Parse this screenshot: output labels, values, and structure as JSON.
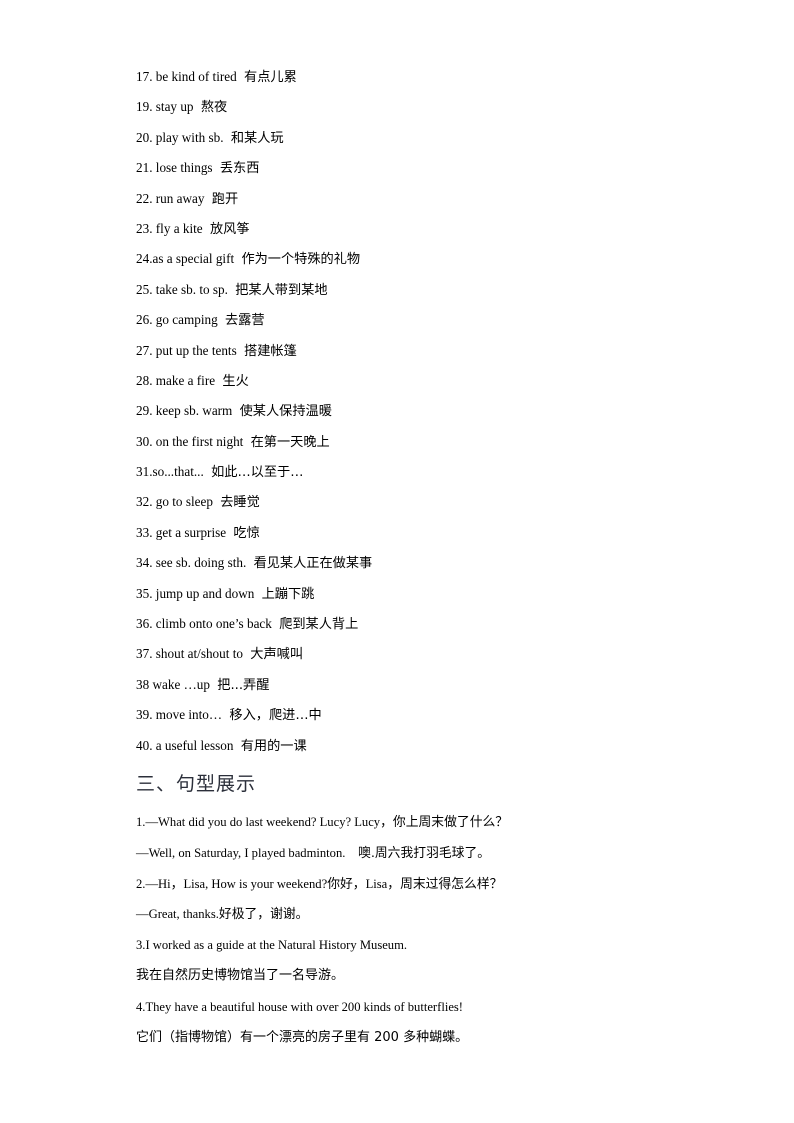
{
  "document": {
    "page_background": "#ffffff",
    "text_color": "#000000",
    "heading_color": "#2b2f3a"
  },
  "phrases": {
    "items": [
      {
        "number": "17.",
        "en": "be kind of tired",
        "cn": "有点儿累"
      },
      {
        "number": "19.",
        "en": "stay up",
        "cn": "熬夜"
      },
      {
        "number": "20.",
        "en": "play with sb.",
        "cn": "和某人玩"
      },
      {
        "number": "21.",
        "en": "lose things",
        "cn": "丢东西"
      },
      {
        "number": "22.",
        "en": "run away",
        "cn": "跑开"
      },
      {
        "number": "23.",
        "en": "fly a kite",
        "cn": "放风筝"
      },
      {
        "number": "24.",
        "en": "as a special gift",
        "cn": "作为一个特殊的礼物"
      },
      {
        "number": "25.",
        "en": "take sb. to sp.",
        "cn": "把某人带到某地"
      },
      {
        "number": "26.",
        "en": "go camping",
        "cn": "去露营"
      },
      {
        "number": "27.",
        "en": "put up the tents",
        "cn": "搭建帐篷"
      },
      {
        "number": "28.",
        "en": "make a fire",
        "cn": "生火"
      },
      {
        "number": "29.",
        "en": "keep sb. warm",
        "cn": "使某人保持温暖"
      },
      {
        "number": "30.",
        "en": "on the first night",
        "cn": "在第一天晚上"
      },
      {
        "number": "31.",
        "en": "so...that...",
        "cn": "如此…以至于…"
      },
      {
        "number": "32.",
        "en": "go to sleep",
        "cn": "去睡觉"
      },
      {
        "number": "33.",
        "en": "get a surprise",
        "cn": "吃惊"
      },
      {
        "number": "34.",
        "en": "see sb. doing sth.",
        "cn": "看见某人正在做某事"
      },
      {
        "number": "35.",
        "en": "jump up and down",
        "cn": "上蹦下跳"
      },
      {
        "number": "36.",
        "en": "climb onto one’s back",
        "cn": "爬到某人背上"
      },
      {
        "number": "37.",
        "en": "shout at/shout to",
        "cn": "大声喊叫"
      },
      {
        "number": "38",
        "en": "wake …up",
        "cn": "把...弄醒"
      },
      {
        "number": "39.",
        "en": "move into…",
        "cn": "移入，爬进…中"
      },
      {
        "number": "40.",
        "en": "a useful lesson",
        "cn": "有用的一课"
      }
    ]
  },
  "sentence_section": {
    "heading": "三、句型展示",
    "lines": [
      {
        "type": "mixed",
        "en": "1.—What did you do last weekend? Lucy? Lucy",
        "cn": "，你上周末做了什么？"
      },
      {
        "type": "mixed",
        "en": "—Well, on Saturday, I played badminton.　",
        "cn": "噢.周六我打羽毛球了。"
      },
      {
        "type": "mixed",
        "en": "2.—Hi",
        "cn": "，",
        "en2": "Lisa, How is your weekend?",
        "cn2": "你好，",
        "en3": "Lisa",
        "cn3": "，周末过得怎么样？"
      },
      {
        "type": "mixed",
        "en": "—Great, thanks.",
        "cn": "好极了，谢谢。"
      },
      {
        "type": "en",
        "en": "3.I worked as a guide at the Natural History Museum."
      },
      {
        "type": "cn",
        "cn": "我在自然历史博物馆当了一名导游。"
      },
      {
        "type": "en",
        "en": "4.They have a beautiful house with over 200 kinds of butterflies!"
      },
      {
        "type": "cn",
        "cn": "它们（指博物馆）有一个漂亮的房子里有 200 多种蝴蝶。"
      }
    ]
  }
}
